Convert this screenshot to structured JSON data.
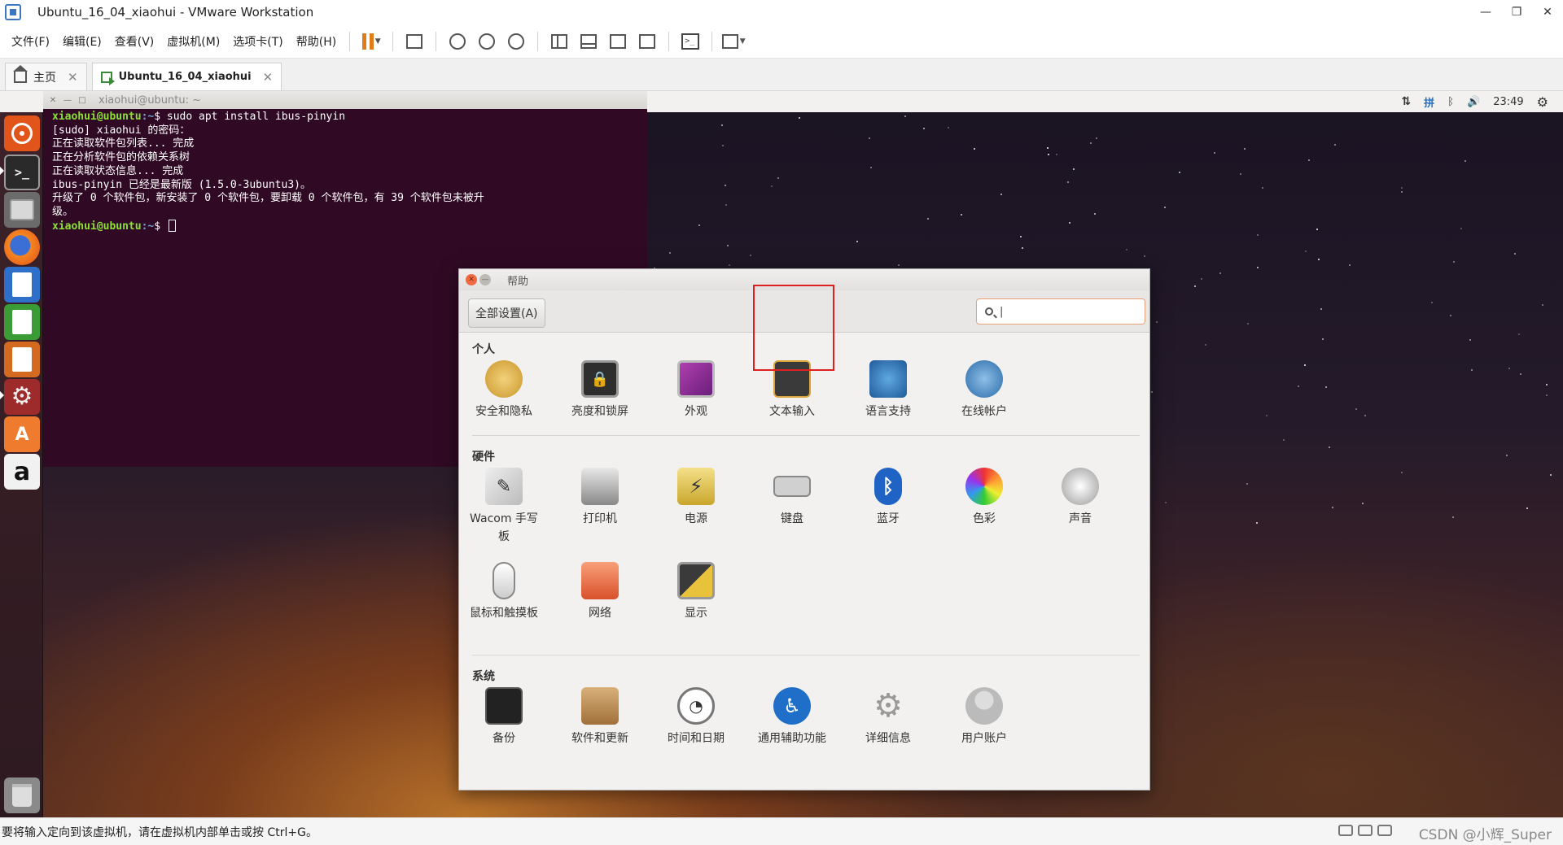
{
  "window": {
    "title": "Ubuntu_16_04_xiaohui - VMware Workstation",
    "controls": [
      "—",
      "❐",
      "✕"
    ]
  },
  "menubar": {
    "items": [
      "文件(F)",
      "编辑(E)",
      "查看(V)",
      "虚拟机(M)",
      "选项卡(T)",
      "帮助(H)"
    ]
  },
  "tabs": [
    {
      "label": "主页",
      "close": "✕"
    },
    {
      "label": "Ubuntu_16_04_xiaohui",
      "close": "✕"
    }
  ],
  "ubuntu_panel": {
    "clock": "23:49",
    "network": "⇅",
    "input_method": "拼",
    "bluetooth": "ᛒ",
    "volume": "🔊",
    "settings": "⚙"
  },
  "launcher": {
    "terminal_glyph": ">_",
    "software_glyph": "A",
    "amazon_glyph": "a"
  },
  "terminal": {
    "title": "xiaohui@ubuntu: ~",
    "buttons": [
      "✕",
      "—",
      "□"
    ],
    "prompt_user": "xiaohui@ubuntu",
    "prompt_path": ":~",
    "prompt_symbol": "$",
    "command": " sudo apt install ibus-pinyin",
    "output": "[sudo] xiaohui 的密码：\n正在读取软件包列表... 完成\n正在分析软件包的依赖关系树\n正在读取状态信息... 完成\nibus-pinyin 已经是最新版 (1.5.0-3ubuntu3)。\n升级了 0 个软件包，新安装了 0 个软件包，要卸载 0 个软件包，有 39 个软件包未被升\n级。",
    "prompt2_user": "xiaohui@ubuntu",
    "prompt2_path": ":~",
    "prompt2_symbol": "$"
  },
  "settings_window": {
    "title": "帮助",
    "close": "✕",
    "minimize": "—",
    "all_settings_label": "全部设置(A)",
    "search_value": "|",
    "sections": {
      "personal": {
        "title": "个人",
        "items": [
          "安全和隐私",
          "亮度和锁屏",
          "外观",
          "文本输入",
          "语言支持",
          "在线帐户"
        ]
      },
      "hardware": {
        "title": "硬件",
        "items": [
          "Wacom 手写板",
          "打印机",
          "电源",
          "键盘",
          "蓝牙",
          "色彩",
          "声音",
          "鼠标和触摸板",
          "网络",
          "显示"
        ]
      },
      "system": {
        "title": "系统",
        "items": [
          "备份",
          "软件和更新",
          "时间和日期",
          "通用辅助功能",
          "详细信息",
          "用户账户"
        ]
      }
    }
  },
  "statusbar": {
    "message": "要将输入定向到该虚拟机，请在虚拟机内部单击或按 Ctrl+G。",
    "watermark": "CSDN @小辉_Super"
  },
  "colors": {
    "terminal_bg": "#300a24",
    "highlight": "#e02020",
    "prompt_green": "#8ae234",
    "prompt_blue": "#729fcf"
  }
}
